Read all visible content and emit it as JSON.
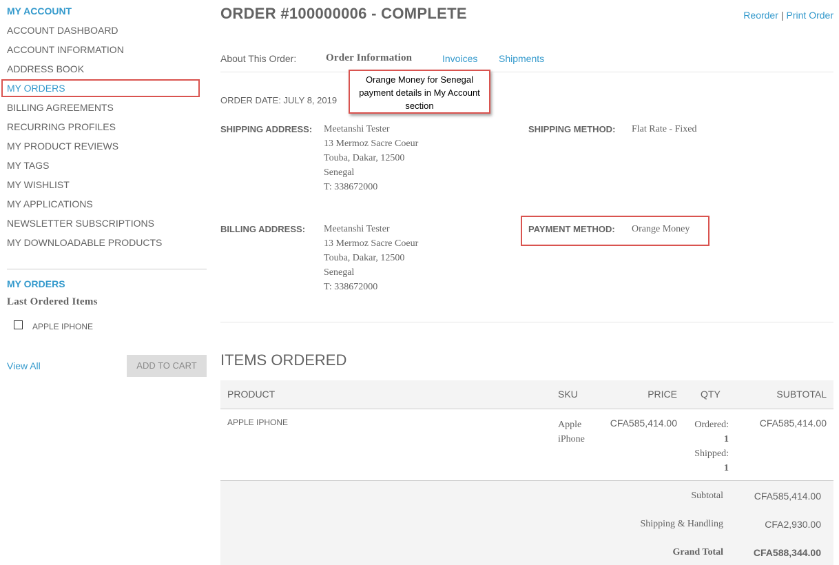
{
  "sidebar": {
    "title": "MY ACCOUNT",
    "items": [
      {
        "label": "ACCOUNT DASHBOARD",
        "active": false
      },
      {
        "label": "ACCOUNT INFORMATION",
        "active": false
      },
      {
        "label": "ADDRESS BOOK",
        "active": false
      },
      {
        "label": "MY ORDERS",
        "active": true
      },
      {
        "label": "BILLING AGREEMENTS",
        "active": false
      },
      {
        "label": "RECURRING PROFILES",
        "active": false
      },
      {
        "label": "MY PRODUCT REVIEWS",
        "active": false
      },
      {
        "label": "MY TAGS",
        "active": false
      },
      {
        "label": "MY WISHLIST",
        "active": false
      },
      {
        "label": "MY APPLICATIONS",
        "active": false
      },
      {
        "label": "NEWSLETTER SUBSCRIPTIONS",
        "active": false
      },
      {
        "label": "MY DOWNLOADABLE PRODUCTS",
        "active": false
      }
    ],
    "orders_title": "MY ORDERS",
    "last_ordered_title": "Last Ordered Items",
    "last_ordered_items": [
      {
        "name": "APPLE IPHONE",
        "checked": false
      }
    ],
    "view_all": "View All",
    "add_to_cart": "ADD TO CART"
  },
  "order": {
    "title": "ORDER #100000006 - COMPLETE",
    "reorder": "Reorder",
    "separator": "|",
    "print_order": "Print Order",
    "about_label": "About This Order:",
    "tabs": [
      {
        "label": "Order Information",
        "active": true
      },
      {
        "label": "Invoices",
        "active": false
      },
      {
        "label": "Shipments",
        "active": false
      }
    ],
    "order_date": "ORDER DATE: JULY 8, 2019",
    "shipping_address_label": "SHIPPING ADDRESS:",
    "shipping_address": [
      "Meetanshi Tester",
      "13 Mermoz Sacre Coeur",
      "Touba, Dakar, 12500",
      "Senegal",
      "T: 338672000"
    ],
    "shipping_method_label": "SHIPPING METHOD:",
    "shipping_method": "Flat Rate - Fixed",
    "billing_address_label": "BILLING ADDRESS:",
    "billing_address": [
      "Meetanshi Tester",
      "13 Mermoz Sacre Coeur",
      "Touba, Dakar, 12500",
      "Senegal",
      "T: 338672000"
    ],
    "payment_method_label": "PAYMENT METHOD:",
    "payment_method": "Orange Money"
  },
  "callout": {
    "text": "Orange Money for Senegal payment details in My Account section"
  },
  "items": {
    "title": "ITEMS ORDERED",
    "headers": {
      "product": "PRODUCT",
      "sku": "SKU",
      "price": "PRICE",
      "qty": "QTY",
      "subtotal": "SUBTOTAL"
    },
    "rows": [
      {
        "product": "APPLE IPHONE",
        "sku_line1": "Apple",
        "sku_line2": "iPhone",
        "price": "CFA585,414.00",
        "ordered_label": "Ordered:",
        "ordered_qty": "1",
        "shipped_label": "Shipped:",
        "shipped_qty": "1",
        "subtotal": "CFA585,414.00"
      }
    ],
    "totals": [
      {
        "label": "Subtotal",
        "value": "CFA585,414.00",
        "bold": false
      },
      {
        "label": "Shipping & Handling",
        "value": "CFA2,930.00",
        "bold": false
      },
      {
        "label": "Grand Total",
        "value": "CFA588,344.00",
        "bold": true
      }
    ]
  },
  "colors": {
    "accent": "#3399cc",
    "highlight": "#d9534f",
    "text": "#636363"
  }
}
